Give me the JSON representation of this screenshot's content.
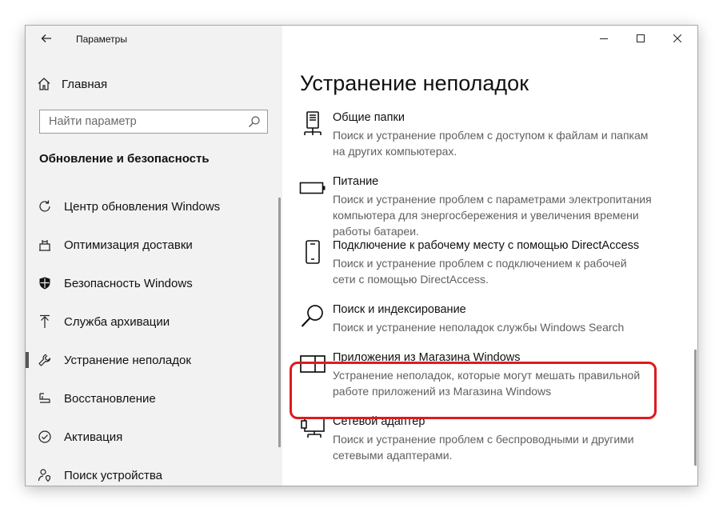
{
  "window": {
    "title": "Параметры",
    "controls": {
      "minimize": "minimize",
      "maximize": "maximize",
      "close": "close"
    }
  },
  "sidebar": {
    "home_label": "Главная",
    "search": {
      "placeholder": "Найти параметр"
    },
    "section_title": "Обновление и безопасность",
    "items": [
      {
        "label": "Центр обновления Windows",
        "icon": "refresh-icon"
      },
      {
        "label": "Оптимизация доставки",
        "icon": "delivery-icon"
      },
      {
        "label": "Безопасность Windows",
        "icon": "shield-icon"
      },
      {
        "label": "Служба архивации",
        "icon": "backup-icon"
      },
      {
        "label": "Устранение неполадок",
        "icon": "wrench-icon",
        "selected": true
      },
      {
        "label": "Восстановление",
        "icon": "recovery-icon"
      },
      {
        "label": "Активация",
        "icon": "check-circle-icon"
      },
      {
        "label": "Поиск устройства",
        "icon": "person-location-icon"
      }
    ]
  },
  "main": {
    "title": "Устранение неполадок",
    "items": [
      {
        "name": "Общие папки",
        "desc": "Поиск и устранение проблем с доступом к файлам и папкам на других компьютерах.",
        "icon": "shared-folder-icon"
      },
      {
        "name": "Питание",
        "desc": "Поиск и устранение проблем с параметрами электропитания компьютера для энергосбережения и увеличения  времени работы батареи.",
        "icon": "battery-icon"
      },
      {
        "name": "Подключение к рабочему месту с помощью DirectAccess",
        "desc": "Поиск и устранение проблем с подключением к рабочей сети с помощью DirectAccess.",
        "icon": "phone-icon"
      },
      {
        "name": "Поиск и индексирование",
        "desc": "Поиск и устранение неполадок службы Windows Search",
        "icon": "search-icon"
      },
      {
        "name": "Приложения из Магазина Windows",
        "desc": "Устранение неполадок, которые могут мешать правильной работе приложений из Магазина Windows",
        "icon": "store-apps-icon",
        "highlighted": true
      },
      {
        "name": "Сетевой адаптер",
        "desc": "Поиск и устранение проблем с беспроводными и другими сетевыми адаптерами.",
        "icon": "network-adapter-icon"
      }
    ]
  },
  "colors": {
    "highlight": "#e0191e",
    "sidebar_bg": "#f2f2f2",
    "text": "#111111",
    "secondary_text": "#5f5f5f"
  }
}
